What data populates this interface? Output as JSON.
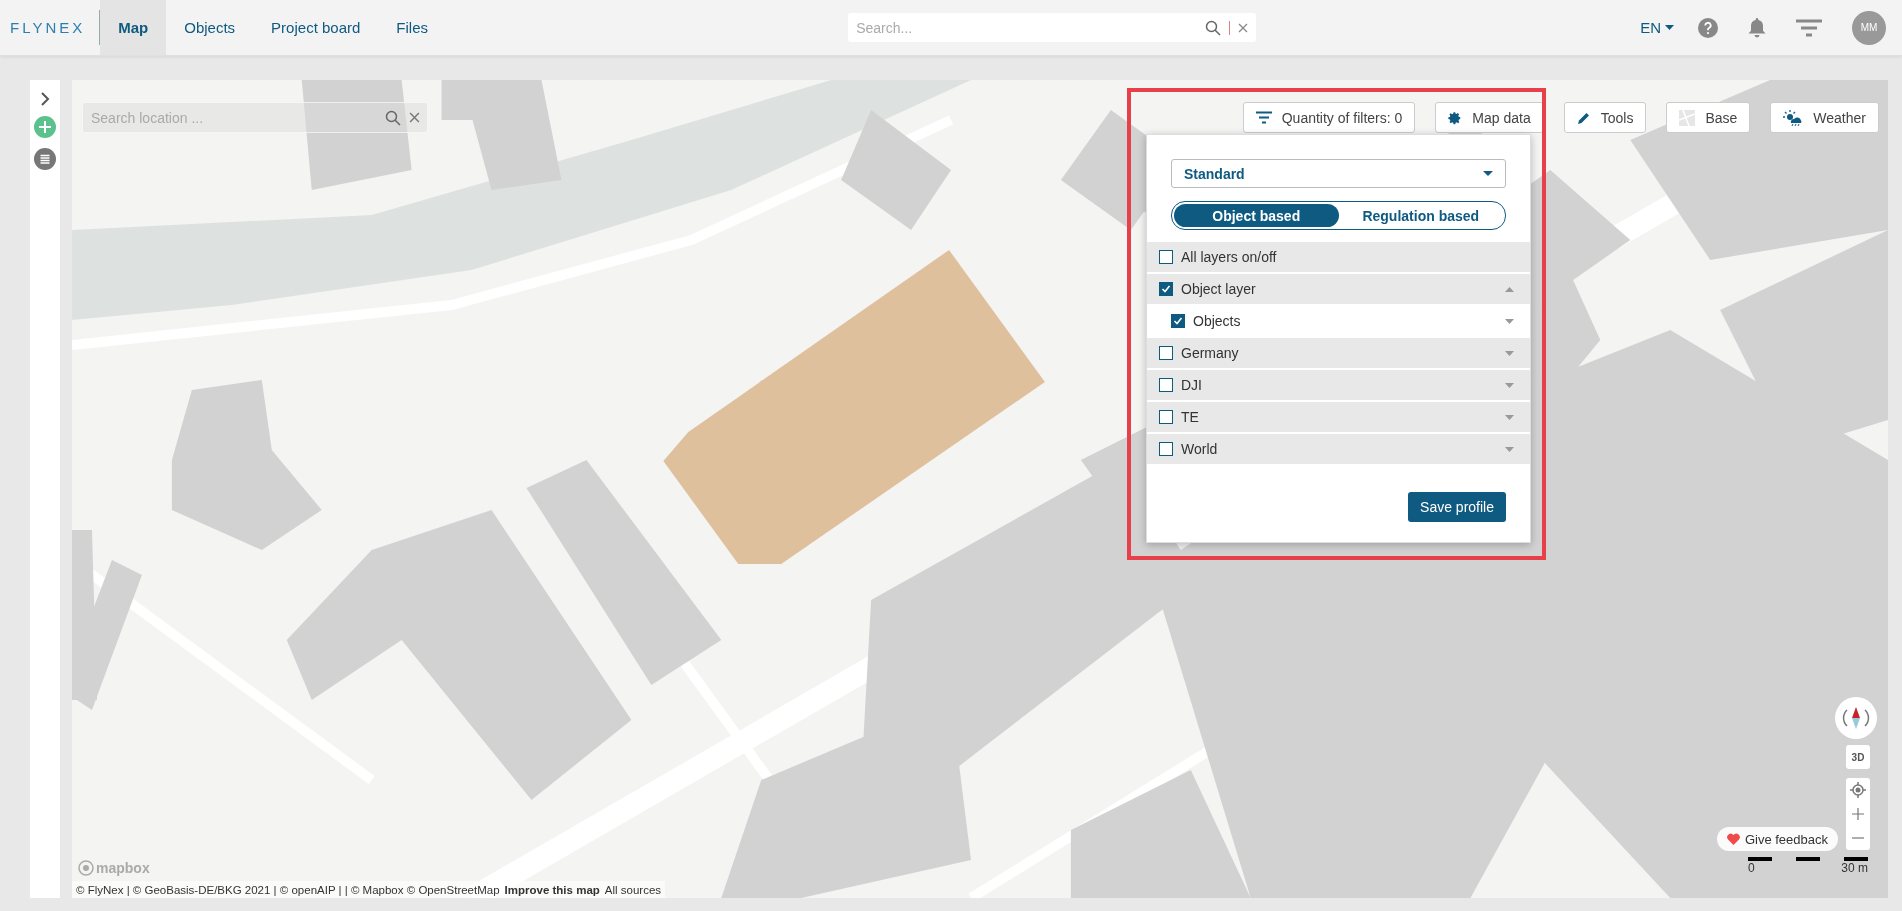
{
  "header": {
    "logo": "FLYNEX",
    "tabs": [
      {
        "label": "Map",
        "selected": true
      },
      {
        "label": "Objects",
        "selected": false
      },
      {
        "label": "Project board",
        "selected": false
      },
      {
        "label": "Files",
        "selected": false
      }
    ],
    "search": {
      "placeholder": "Search..."
    },
    "language": "EN",
    "avatar": "MM"
  },
  "map": {
    "location_search": {
      "placeholder": "Search location ..."
    },
    "filters_button": "Quantity of filters: 0",
    "buttons": [
      {
        "label": "Map data",
        "kind": "gear"
      },
      {
        "label": "Tools",
        "kind": "pencil"
      },
      {
        "label": "Base",
        "kind": "base"
      },
      {
        "label": "Weather",
        "kind": "weather"
      }
    ],
    "layer_panel": {
      "profile": "Standard",
      "modes": [
        {
          "label": "Object based",
          "selected": true
        },
        {
          "label": "Regulation based",
          "selected": false
        }
      ],
      "all_layers": {
        "label": "All layers on/off",
        "checked": false
      },
      "layers": [
        {
          "label": "Object layer",
          "checked": true,
          "expanded": true,
          "children": [
            {
              "label": "Objects",
              "checked": true,
              "expanded": false
            }
          ]
        },
        {
          "label": "Germany",
          "checked": false,
          "expanded": false
        },
        {
          "label": "DJI",
          "checked": false,
          "expanded": false
        },
        {
          "label": "TE",
          "checked": false,
          "expanded": false
        },
        {
          "label": "World",
          "checked": false,
          "expanded": false
        }
      ],
      "save_button": "Save profile"
    },
    "three_d": "3D",
    "feedback": "Give feedback",
    "scale": {
      "start": "0",
      "end": "30 m"
    },
    "mapbox_logo": "mapbox",
    "attribution": {
      "text": "© FlyNex | © GeoBasis-DE/BKG 2021 | © openAIP | | © Mapbox © OpenStreetMap",
      "improve": "Improve this map",
      "sources": "All sources"
    }
  }
}
